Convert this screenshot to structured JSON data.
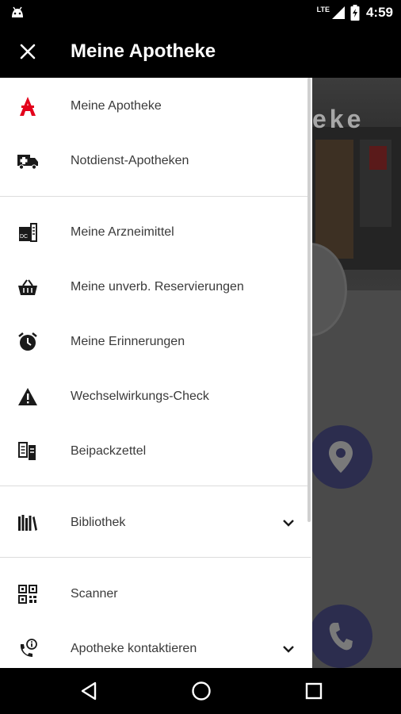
{
  "status_bar": {
    "network_label": "LTE",
    "time": "4:59"
  },
  "toolbar": {
    "title": "Meine Apotheke"
  },
  "background": {
    "shop_sign": "eke"
  },
  "drawer": {
    "sections": [
      {
        "items": [
          {
            "label": "Meine Apotheke",
            "icon": "pharmacy-logo-icon",
            "accent": "#e3001b"
          },
          {
            "label": "Notdienst-Apotheken",
            "icon": "ambulance-icon"
          }
        ]
      },
      {
        "items": [
          {
            "label": "Meine Arzneimittel",
            "icon": "medicine-box-icon"
          },
          {
            "label": "Meine unverb. Reservierungen",
            "icon": "shopping-basket-icon"
          },
          {
            "label": "Meine Erinnerungen",
            "icon": "alarm-clock-icon"
          },
          {
            "label": "Wechselwirkungs-Check",
            "icon": "warning-icon"
          },
          {
            "label": "Beipackzettel",
            "icon": "leaflet-icon"
          }
        ]
      },
      {
        "items": [
          {
            "label": "Bibliothek",
            "icon": "library-books-icon",
            "expandable": true
          }
        ]
      },
      {
        "items": [
          {
            "label": "Scanner",
            "icon": "qr-code-icon"
          },
          {
            "label": "Apotheke kontaktieren",
            "icon": "phone-info-icon",
            "expandable": true
          }
        ]
      }
    ]
  },
  "colors": {
    "accent_red": "#e3001b",
    "fab_blue": "#2c2d4e",
    "toolbar_bg": "#000000"
  }
}
